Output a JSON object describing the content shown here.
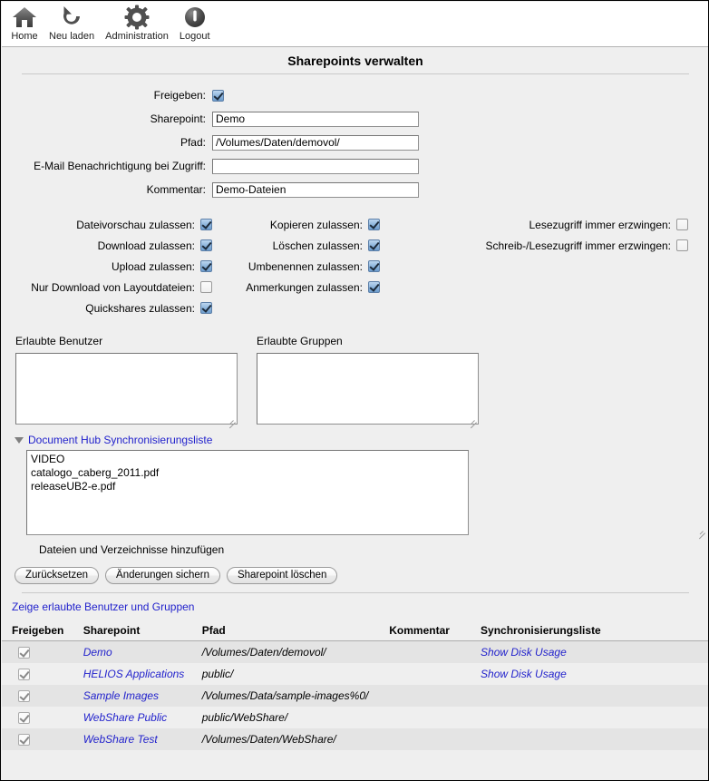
{
  "toolbar": {
    "items": [
      {
        "label": "Home",
        "icon": "home-icon"
      },
      {
        "label": "Neu laden",
        "icon": "reload-icon"
      },
      {
        "label": "Administration",
        "icon": "gear-icon"
      },
      {
        "label": "Logout",
        "icon": "power-icon"
      }
    ]
  },
  "page": {
    "title": "Sharepoints verwalten"
  },
  "form": {
    "share_label": "Freigeben:",
    "share_checked": true,
    "fields": [
      {
        "label": "Sharepoint:",
        "value": "Demo",
        "placeholder": ""
      },
      {
        "label": "Pfad:",
        "value": "/Volumes/Daten/demovol/",
        "placeholder": ""
      },
      {
        "label": "E-Mail Benachrichtigung bei Zugriff:",
        "value": "",
        "placeholder": ""
      },
      {
        "label": "Kommentar:",
        "value": "Demo-Dateien",
        "placeholder": ""
      }
    ]
  },
  "permissions": {
    "rows": [
      {
        "a": {
          "label": "Dateivorschau zulassen:",
          "checked": true
        },
        "b": {
          "label": "Kopieren zulassen:",
          "checked": true
        },
        "c": {
          "label": "Lesezugriff immer erzwingen:",
          "checked": false
        }
      },
      {
        "a": {
          "label": "Download zulassen:",
          "checked": true
        },
        "b": {
          "label": "Löschen zulassen:",
          "checked": true
        },
        "c": {
          "label": "Schreib-/Lesezugriff immer erzwingen:",
          "checked": false
        }
      },
      {
        "a": {
          "label": "Upload zulassen:",
          "checked": true
        },
        "b": {
          "label": "Umbenennen zulassen:",
          "checked": true
        },
        "c": {
          "label": "",
          "checked": null
        }
      },
      {
        "a": {
          "label": "Nur Download von Layoutdateien:",
          "checked": false
        },
        "b": {
          "label": "Anmerkungen zulassen:",
          "checked": true
        },
        "c": {
          "label": "",
          "checked": null
        }
      },
      {
        "a": {
          "label": "Quickshares zulassen:",
          "checked": true
        },
        "b": {
          "label": "",
          "checked": null
        },
        "c": {
          "label": "",
          "checked": null
        }
      }
    ]
  },
  "lists": {
    "users_heading": "Erlaubte Benutzer",
    "users_value": "",
    "groups_heading": "Erlaubte Gruppen",
    "groups_value": ""
  },
  "dochub": {
    "link": "Document Hub Synchronisierungsliste",
    "expanded": true,
    "sync_value": "VIDEO\ncatalogo_caberg_2011.pdf\nreleaseUB2-e.pdf",
    "caption": "Dateien und Verzeichnisse hinzufügen"
  },
  "buttons": {
    "reset": "Zurücksetzen",
    "save": "Änderungen sichern",
    "delete": "Sharepoint löschen"
  },
  "show_link": "Zeige erlaubte Benutzer und Gruppen",
  "table": {
    "headers": {
      "share": "Freigeben",
      "sharepoint": "Sharepoint",
      "path": "Pfad",
      "comment": "Kommentar",
      "synclist": "Synchronisierungsliste"
    },
    "rows": [
      {
        "share_checked": true,
        "sharepoint": "Demo",
        "path": "/Volumes/Daten/demovol/",
        "comment": "",
        "synclist": "Show Disk Usage"
      },
      {
        "share_checked": true,
        "sharepoint": "HELIOS Applications",
        "path": "public/",
        "comment": "",
        "synclist": "Show Disk Usage"
      },
      {
        "share_checked": true,
        "sharepoint": "Sample Images",
        "path": "/Volumes/Data/sample-images%0/",
        "comment": "",
        "synclist": ""
      },
      {
        "share_checked": true,
        "sharepoint": "WebShare Public",
        "path": "public/WebShare/",
        "comment": "",
        "synclist": ""
      },
      {
        "share_checked": true,
        "sharepoint": "WebShare Test",
        "path": "/Volumes/Daten/WebShare/",
        "comment": "",
        "synclist": ""
      }
    ]
  },
  "colors": {
    "link": "#2222cc",
    "page_bg": "#efefef",
    "row_alt": "#e4e4e4"
  }
}
